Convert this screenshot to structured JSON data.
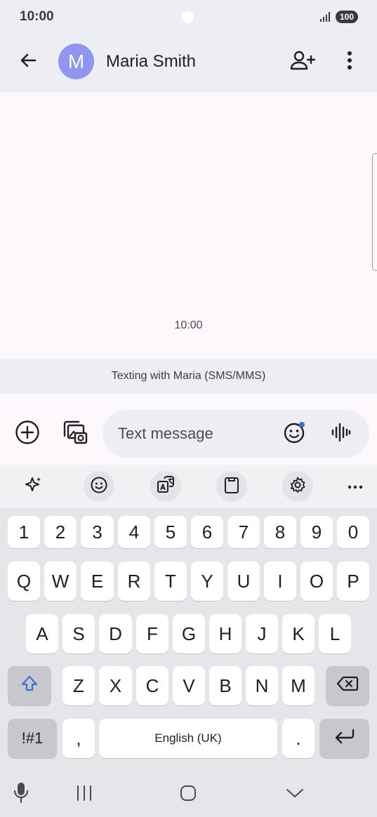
{
  "status_bar": {
    "time": "10:00",
    "battery": "100",
    "icons": [
      "camera-cutout",
      "signal-icon",
      "battery-icon"
    ]
  },
  "app_bar": {
    "avatar_letter": "M",
    "avatar_color": "#8f95f1",
    "contact_name": "Maria Smith",
    "icons": [
      "back-arrow-icon",
      "add-person-icon",
      "more-vertical-icon"
    ]
  },
  "conversation": {
    "timestamp": "10:00"
  },
  "sms_banner": {
    "text": "Texting with Maria (SMS/MMS)"
  },
  "compose": {
    "placeholder": "Text message",
    "icons": [
      "add-circle-icon",
      "gallery-icon",
      "emoji-icon",
      "voice-wave-icon"
    ]
  },
  "keyboard_toolbar": {
    "icons": [
      "sparkle-icon",
      "smiley-icon",
      "translate-icon",
      "clipboard-icon",
      "settings-icon",
      "more-horizontal-icon"
    ]
  },
  "keyboard": {
    "number_row": [
      "1",
      "2",
      "3",
      "4",
      "5",
      "6",
      "7",
      "8",
      "9",
      "0"
    ],
    "row1": [
      "Q",
      "W",
      "E",
      "R",
      "T",
      "Y",
      "U",
      "I",
      "O",
      "P"
    ],
    "row2": [
      "A",
      "S",
      "D",
      "F",
      "G",
      "H",
      "J",
      "K",
      "L"
    ],
    "row3": [
      "Z",
      "X",
      "C",
      "V",
      "B",
      "N",
      "M"
    ],
    "symbols_label": "!#1",
    "comma": ",",
    "space_label": "English (UK)",
    "period": ".",
    "shift_icon": "shift-icon",
    "backspace_icon": "backspace-icon",
    "enter_icon": "enter-icon",
    "accent_color": "#3b6fd8"
  },
  "nav_bar": {
    "icons": [
      "microphone-icon",
      "recents-icon",
      "home-icon",
      "hide-keyboard-icon"
    ]
  }
}
